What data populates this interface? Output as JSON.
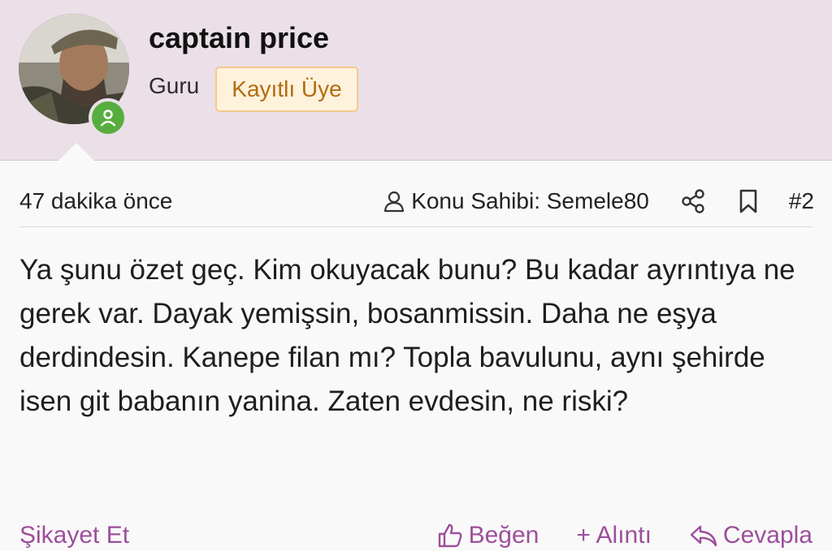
{
  "user": {
    "name": "captain price",
    "rank": "Guru",
    "badge": "Kayıtlı Üye",
    "online": true
  },
  "post": {
    "time": "47 dakika önce",
    "thread_owner": "Konu Sahibi: Semele80",
    "number": "#2",
    "message": "Ya şunu özet geç. Kim okuyacak bunu? Bu kadar ayrıntıya ne gerek var. Dayak yemişsin, bosanmissin. Daha ne eşya derdindesin. Kanepe filan mı? Topla bavulunu, aynı şehirde isen git babanın yanina. Zaten evdesin, ne riski?"
  },
  "actions": {
    "report": "Şikayet Et",
    "like": "Beğen",
    "quote": "+ Alıntı",
    "reply": "Cevapla"
  },
  "icons": {
    "owner": "user-icon",
    "share": "share-icon",
    "bookmark": "bookmark-icon",
    "like": "thumbs-up-icon",
    "reply": "reply-icon",
    "online": "user-online-icon"
  },
  "colors": {
    "header_bg": "#ebe0e8",
    "badge_bg": "#fff2dc",
    "badge_border": "#f2c98c",
    "badge_text": "#b36b10",
    "action_text": "#9c4f9c",
    "online_green": "#58ad3f"
  }
}
